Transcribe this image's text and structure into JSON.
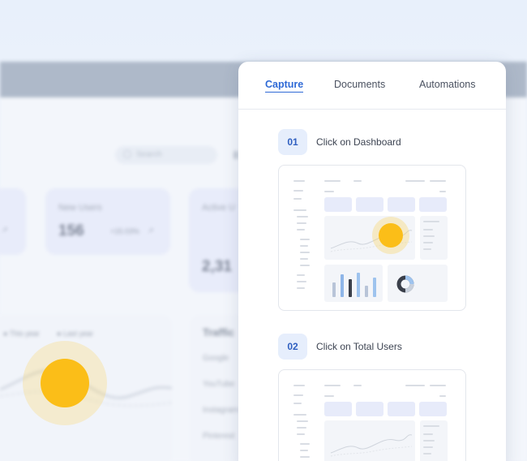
{
  "background_app": {
    "stats": [
      {
        "label": "New Users",
        "value": "156",
        "change": "+15.03%"
      },
      {
        "label": "Active U",
        "value": "2,31"
      }
    ],
    "legend": [
      "This year",
      "Last year"
    ],
    "traffic": {
      "title": "Traffic",
      "items": [
        "Google",
        "YouTube",
        "Instagram",
        "Pinterest"
      ]
    },
    "search_placeholder": "Search"
  },
  "panel": {
    "tabs": [
      {
        "label": "Capture",
        "active": true
      },
      {
        "label": "Documents",
        "active": false
      },
      {
        "label": "Automations",
        "active": false
      }
    ],
    "steps": [
      {
        "number": "01",
        "label": "Click on Dashboard"
      },
      {
        "number": "02",
        "label": "Click on Total Users"
      }
    ]
  },
  "colors": {
    "accent": "#2f6ad6",
    "highlight": "#fbbe18",
    "step_badge_bg": "#e6eefc",
    "stat_card_bg": "#e8ecfa",
    "topbar": "#aeb9c9"
  }
}
